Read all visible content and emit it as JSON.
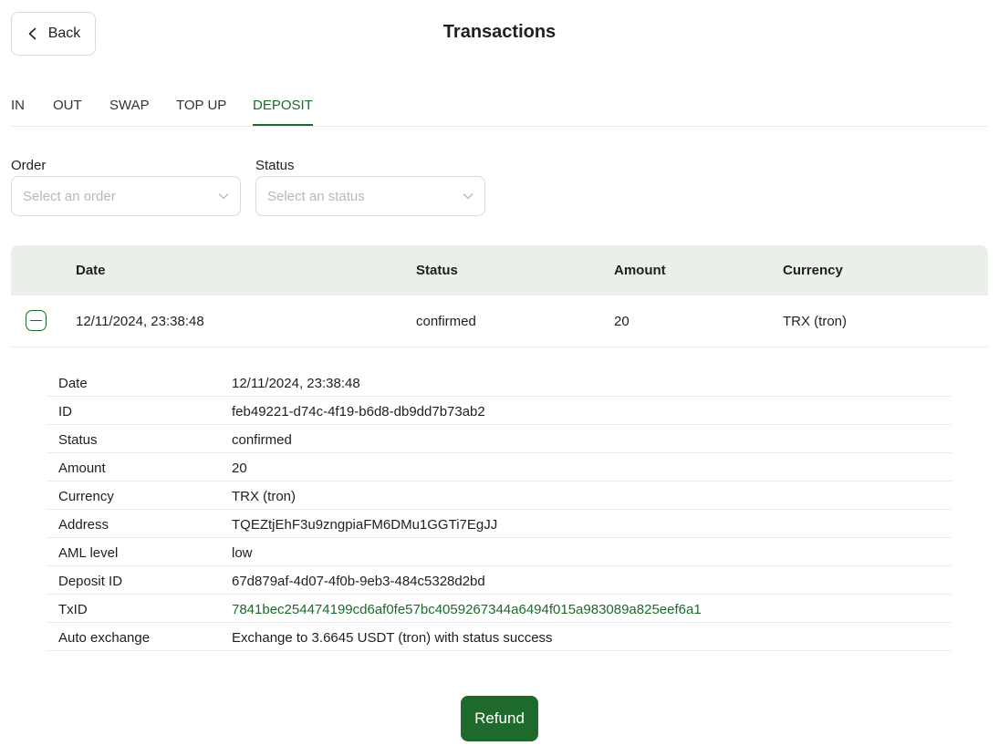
{
  "header": {
    "back_label": "Back",
    "title": "Transactions"
  },
  "tabs": [
    {
      "label": "IN",
      "active": false
    },
    {
      "label": "OUT",
      "active": false
    },
    {
      "label": "SWAP",
      "active": false
    },
    {
      "label": "TOP UP",
      "active": false
    },
    {
      "label": "DEPOSIT",
      "active": true
    }
  ],
  "filters": {
    "order": {
      "label": "Order",
      "placeholder": "Select an order",
      "value": ""
    },
    "status": {
      "label": "Status",
      "placeholder": "Select an status",
      "value": ""
    }
  },
  "table": {
    "columns": [
      "Date",
      "Status",
      "Amount",
      "Currency"
    ],
    "rows": [
      {
        "date": "12/11/2024, 23:38:48",
        "status": "confirmed",
        "amount": "20",
        "currency": "TRX (tron)",
        "expanded": true
      }
    ]
  },
  "details": [
    {
      "key": "Date",
      "value": "12/11/2024, 23:38:48"
    },
    {
      "key": "ID",
      "value": "feb49221-d74c-4f19-b6d8-db9dd7b73ab2"
    },
    {
      "key": "Status",
      "value": "confirmed"
    },
    {
      "key": "Amount",
      "value": "20"
    },
    {
      "key": "Currency",
      "value": "TRX (tron)"
    },
    {
      "key": "Address",
      "value": "TQEZtjEhF3u9zngpiaFM6DMu1GGTi7EgJJ"
    },
    {
      "key": "AML level",
      "value": "low"
    },
    {
      "key": "Deposit ID",
      "value": "67d879af-4d07-4f0b-9eb3-484c5328d2bd"
    },
    {
      "key": "TxID",
      "value": "7841bec254474199cd6af0fe57bc4059267344a6494f015a983089a825eef6a1"
    },
    {
      "key": "Auto exchange",
      "value": "Exchange to 3.6645 USDT (tron) with status success"
    }
  ],
  "actions": {
    "refund_label": "Refund"
  },
  "colors": {
    "accent": "#1d6a2b",
    "table_header_bg": "#e8f0e8"
  },
  "icons": {
    "back": "chevron-left-icon",
    "select": "chevron-down-icon",
    "collapse": "minus-square-icon"
  }
}
